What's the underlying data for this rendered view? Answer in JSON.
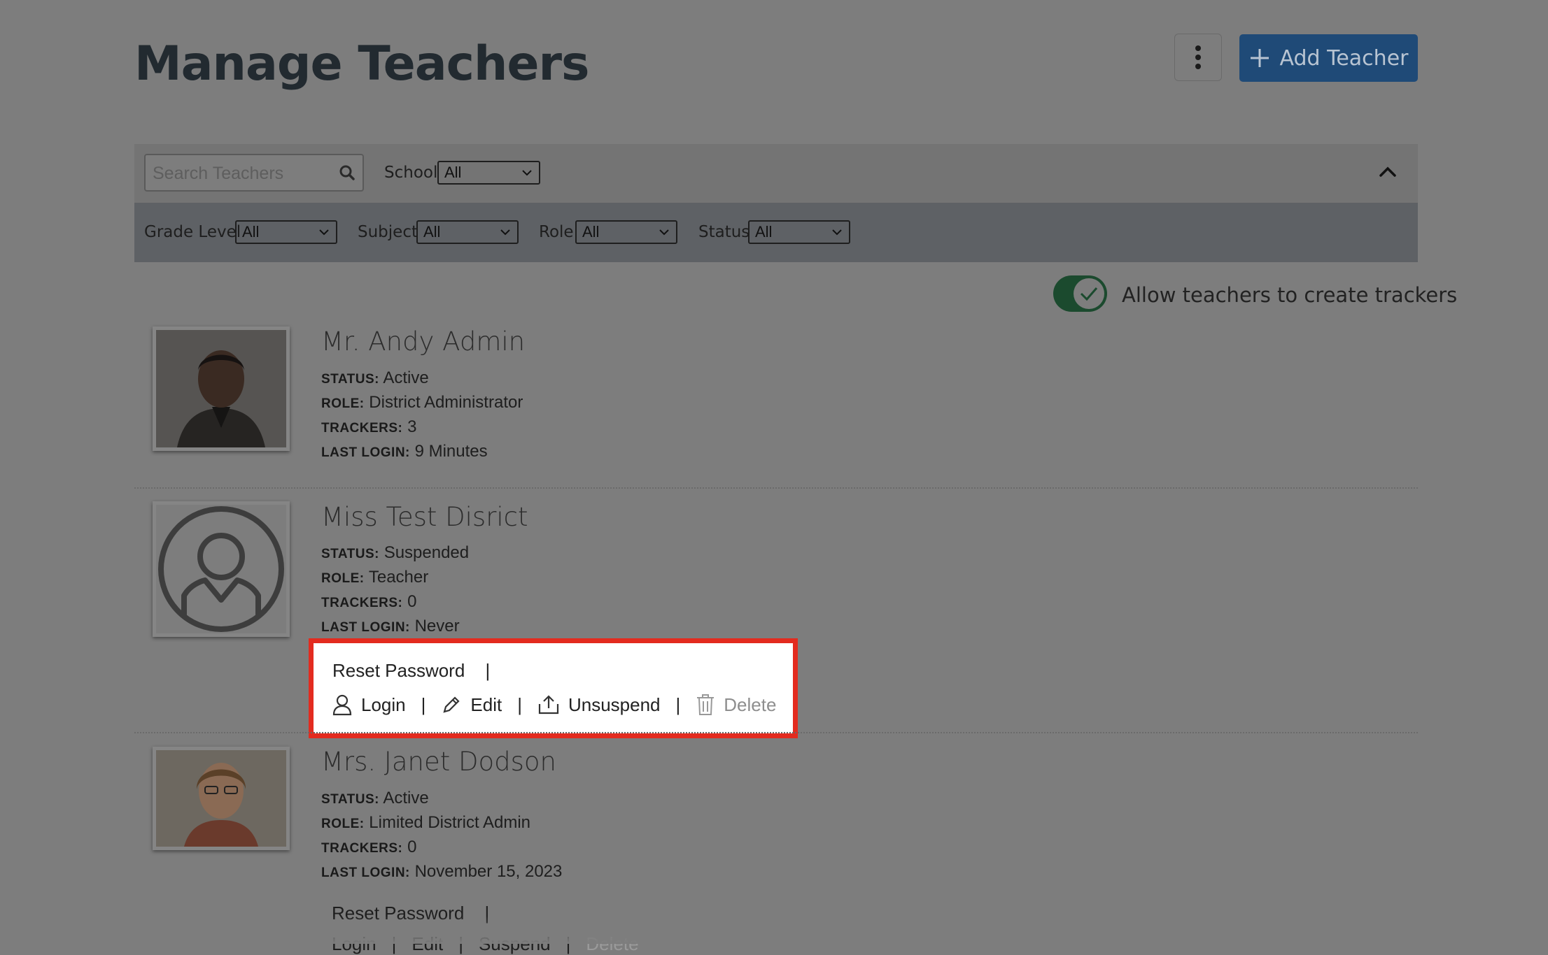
{
  "page": {
    "title": "Manage Teachers"
  },
  "header": {
    "add_button_label": "Add Teacher"
  },
  "filters": {
    "search_placeholder": "Search Teachers",
    "school_label": "School",
    "school_value": "All",
    "grade_label": "Grade Level",
    "grade_value": "All",
    "subject_label": "Subject",
    "subject_value": "All",
    "role_label": "Role",
    "role_value": "All",
    "status_label": "Status",
    "status_value": "All"
  },
  "settings": {
    "allow_trackers_label": "Allow teachers to create trackers",
    "allow_trackers_on": true
  },
  "field_labels": {
    "status": "Status:",
    "role": "Role:",
    "trackers": "Trackers:",
    "last_login": "Last Login:"
  },
  "actions": {
    "reset_password": "Reset Password",
    "separator": "|",
    "login": "Login",
    "edit": "Edit",
    "unsuspend": "Unsuspend",
    "suspend": "Suspend",
    "delete": "Delete"
  },
  "teachers": [
    {
      "name": "Mr. Andy Admin",
      "status": "Active",
      "role": "District Administrator",
      "trackers": "3",
      "last_login": "9 Minutes"
    },
    {
      "name": "Miss Test Disrict",
      "status": "Suspended",
      "role": "Teacher",
      "trackers": "0",
      "last_login": "Never"
    },
    {
      "name": "Mrs. Janet Dodson",
      "status": "Active",
      "role": "Limited District Admin",
      "trackers": "0",
      "last_login": "November 15, 2023"
    }
  ]
}
